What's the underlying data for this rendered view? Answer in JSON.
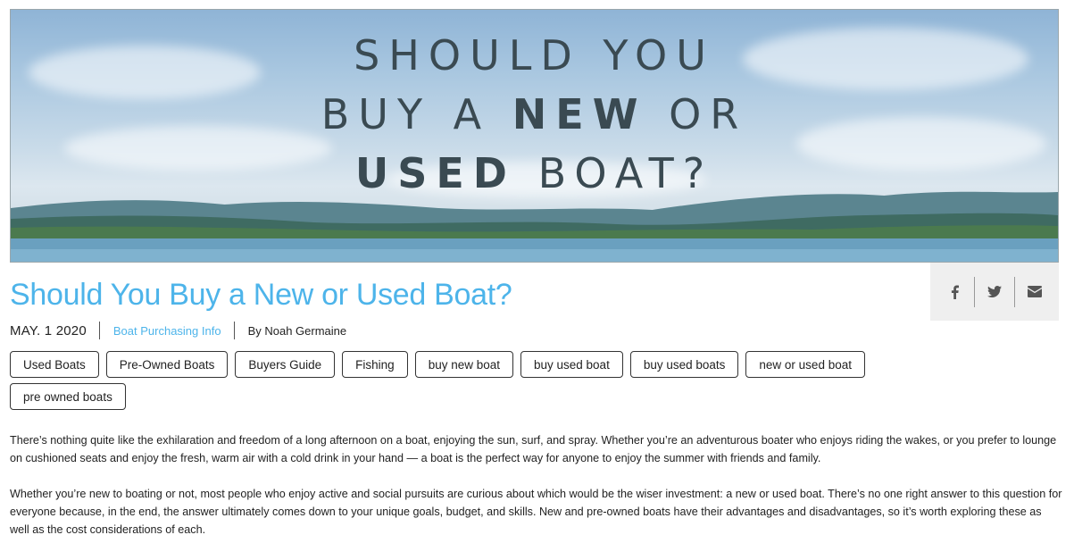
{
  "hero": {
    "line1": "SHOULD YOU",
    "line2_pre": "BUY A ",
    "line2_bold": "NEW",
    "line2_post": " OR",
    "line3_bold": "USED",
    "line3_post": " BOAT?"
  },
  "share": {
    "icons": [
      "facebook-icon",
      "twitter-icon",
      "email-icon"
    ]
  },
  "article": {
    "title": "Should You Buy a New or Used Boat?",
    "date": "MAY. 1 2020",
    "category": "Boat Purchasing Info",
    "author": "By Noah Germaine",
    "tags": [
      "Used Boats",
      "Pre-Owned Boats",
      "Buyers Guide",
      "Fishing",
      "buy new boat",
      "buy used boat",
      "buy used boats",
      "new or used boat",
      "pre owned boats"
    ],
    "paragraph1": "There’s nothing quite like the exhilaration and freedom of a long afternoon on a boat, enjoying the sun, surf, and spray. Whether you’re an adventurous boater who enjoys riding the wakes, or you prefer to lounge on cushioned seats and enjoy the fresh, warm air with a cold drink in your hand — a boat is the perfect way for anyone to enjoy the summer with friends and family.",
    "paragraph2": "Whether you’re new to boating or not, most people who enjoy active and social pursuits are curious about which would be the wiser investment: a new or used boat. There’s no one right answer to this question for everyone because, in the end, the answer ultimately comes down to your unique goals, budget, and skills. New and pre-owned boats have their advantages and disadvantages, so it’s worth exploring these as well as the cost considerations of each."
  },
  "colors": {
    "accent": "#4db4ea",
    "text": "#222222",
    "share_bg": "#efefef"
  }
}
